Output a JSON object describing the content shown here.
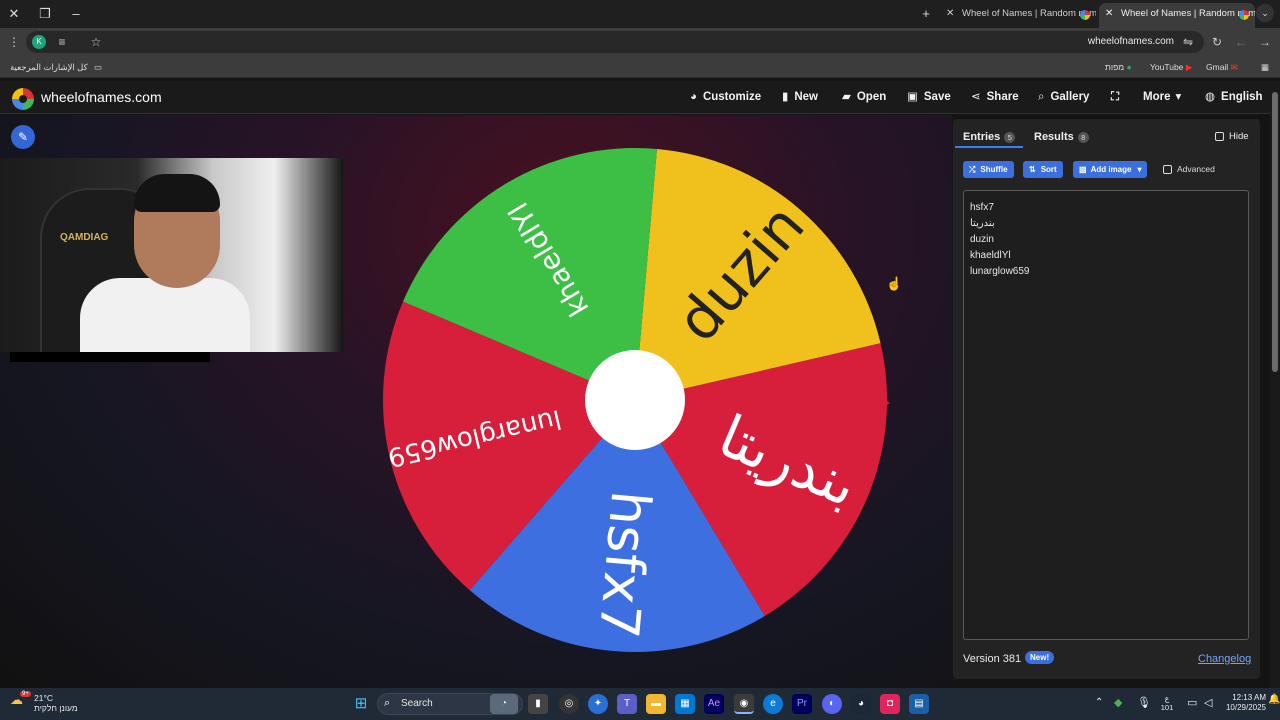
{
  "browser": {
    "tabs": [
      {
        "title": "Wheel of Names | Random nam",
        "active": false
      },
      {
        "title": "Wheel of Names | Random nam",
        "active": true
      }
    ],
    "url": "wheelofnames.com",
    "profile_initial": "K",
    "bookmarks": {
      "all_bookmarks": "كل الإشارات المرجعية",
      "maps": "מפות",
      "youtube": "YouTube",
      "gmail": "Gmail"
    }
  },
  "site": {
    "brand": "wheelofnames.com",
    "nav": {
      "customize": "Customize",
      "new": "New",
      "open": "Open",
      "save": "Save",
      "share": "Share",
      "gallery": "Gallery",
      "more": "More",
      "language": "English"
    }
  },
  "webcam": {
    "chair_text": "QAMDIAG"
  },
  "wheel": {
    "segments": [
      {
        "label": "duzin",
        "color": "#f0c01c"
      },
      {
        "label": "بندريتا",
        "color": "#d71f3c"
      },
      {
        "label": "hsfx7",
        "color": "#3e6fe0"
      },
      {
        "label": "lunarglow659",
        "color": "#d71f3c"
      },
      {
        "label": "khaeldlYl",
        "color": "#3cbf44"
      }
    ]
  },
  "panel": {
    "entries_tab": "Entries",
    "entries_count": "5",
    "results_tab": "Results",
    "results_count": "8",
    "hide": "Hide",
    "shuffle": "Shuffle",
    "sort": "Sort",
    "add_image": "Add image",
    "advanced": "Advanced",
    "entries": [
      "hsfx7",
      "بندريتا",
      "duzin",
      "khaeldlYl",
      "lunarglow659"
    ],
    "version": "Version 381",
    "new_badge": "New!",
    "changelog": "Changelog"
  },
  "taskbar": {
    "temperature": "21°C",
    "weather_desc": "מעונן חלקית",
    "weather_badge": "9+",
    "search": "Search",
    "time": "12:13 AM",
    "date": "10/29/2025",
    "lang_top": "ع",
    "lang_bottom": "101"
  }
}
